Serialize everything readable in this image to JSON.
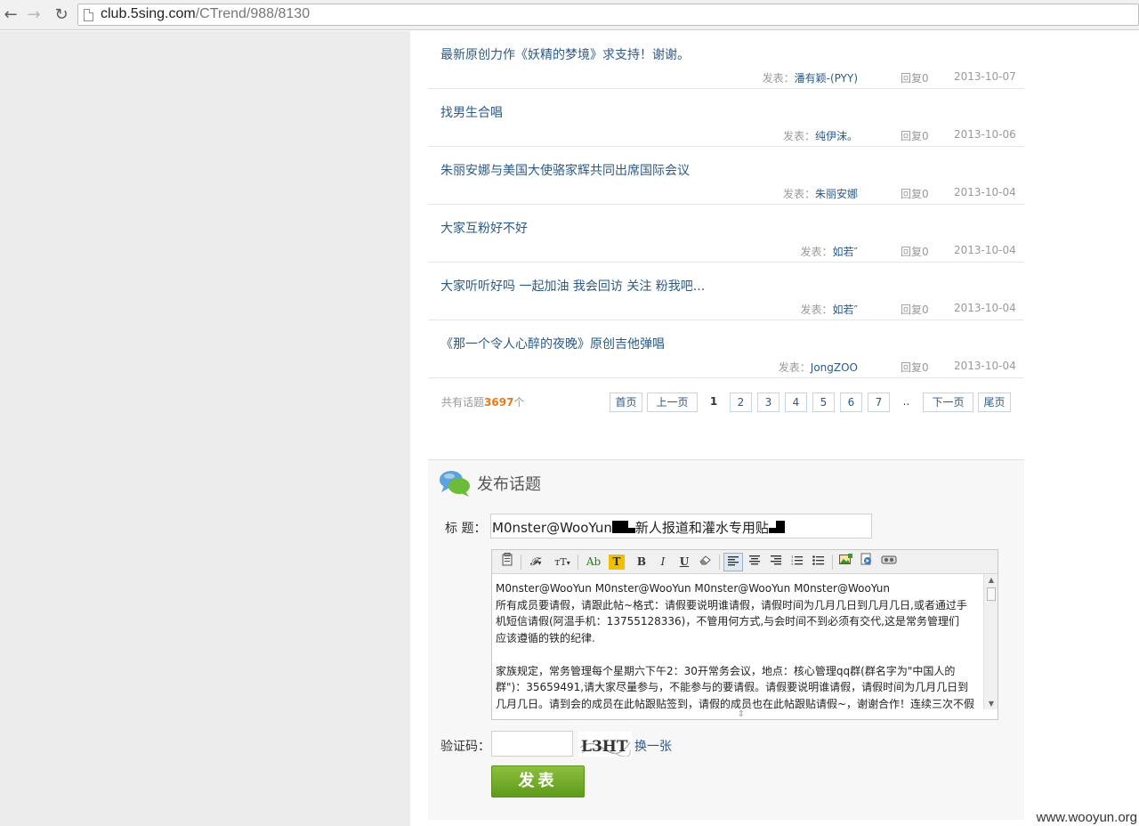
{
  "browser": {
    "url_host": "club.5sing.com",
    "url_path": "/CTrend/988/8130"
  },
  "topics": [
    {
      "title": "最新原创力作《妖精的梦境》求支持！谢谢。",
      "author_label": "发表：",
      "author": "潘有颖-(PYY)",
      "replies": "回复0",
      "date": "2013-10-07"
    },
    {
      "title": "找男生合唱",
      "author_label": "发表：",
      "author": "纯伊沫。",
      "replies": "回复0",
      "date": "2013-10-06"
    },
    {
      "title": "朱丽安娜与美国大使骆家辉共同出席国际会议",
      "author_label": "发表：",
      "author": "朱丽安娜",
      "replies": "回复0",
      "date": "2013-10-04"
    },
    {
      "title": "大家互粉好不好",
      "author_label": "发表：",
      "author": "如若″",
      "replies": "回复0",
      "date": "2013-10-04"
    },
    {
      "title": "大家听听好吗 一起加油 我会回访 关注 粉我吧...",
      "author_label": "发表：",
      "author": "如若″",
      "replies": "回复0",
      "date": "2013-10-04"
    },
    {
      "title": "《那一个令人心醉的夜晚》原创吉他弹唱",
      "author_label": "发表：",
      "author": "JongZOO",
      "replies": "回复0",
      "date": "2013-10-04"
    }
  ],
  "pagination": {
    "total_prefix": "共有话题",
    "total_count": "3697",
    "total_suffix": "个",
    "first": "首页",
    "prev": "上一页",
    "current": "1",
    "pages": [
      "2",
      "3",
      "4",
      "5",
      "6",
      "7"
    ],
    "ellipsis": "..",
    "next": "下一页",
    "last": "尾页"
  },
  "post": {
    "panel_title": "发布话题",
    "title_label": "标  题：",
    "title_value_prefix": "M0nster@WooYun",
    "title_value_middle": "新人报道和灌水专用贴",
    "editor_lines": [
      "M0nster@WooYun   M0nster@WooYun   M0nster@WooYun   M0nster@WooYun",
      "所有成员要请假，请跟此帖~格式：请假要说明谁请假，请假时间为几月几日到几月几日,或者通过手",
      "机短信请假(阿温手机：13755128336)，不管用何方式,与会时间不到必须有交代,这是常务管理们",
      "应该遵循的铁的纪律.",
      "",
      "家族规定，常务管理每个星期六下午2：30开常务会议，地点：核心管理qq群(群名字为\"中国人的",
      "群\")：35659491,请大家尽量参与，不能参与的要请假。请假要说明谁请假，请假时间为几月几日到",
      "几月几日。请到会的成员在此帖跟贴签到，请假的成员也在此帖跟贴请假~，谢谢合作！连续三次不假"
    ],
    "captcha_label": "验证码：",
    "captcha_text": "L3HT",
    "captcha_refresh": "换一张",
    "submit_label": "发表"
  },
  "toolbar_icons": [
    "paste-icon",
    "font-family-icon",
    "font-size-icon",
    "font-color-icon",
    "highlight-icon",
    "bold-icon",
    "italic-icon",
    "underline-icon",
    "eraser-icon",
    "align-left-icon",
    "align-center-icon",
    "align-right-icon",
    "ordered-list-icon",
    "unordered-list-icon",
    "insert-image-icon",
    "insert-media-icon",
    "insert-video-icon"
  ],
  "toolbar_labels": {
    "font_color": "Ab",
    "highlight": "T",
    "bold": "B",
    "italic": "I",
    "underline": "U"
  },
  "colors": {
    "link": "#2b5a8a",
    "count": "#e87a1a",
    "submit": "#6fa726"
  },
  "watermark": "www.wooyun.org"
}
